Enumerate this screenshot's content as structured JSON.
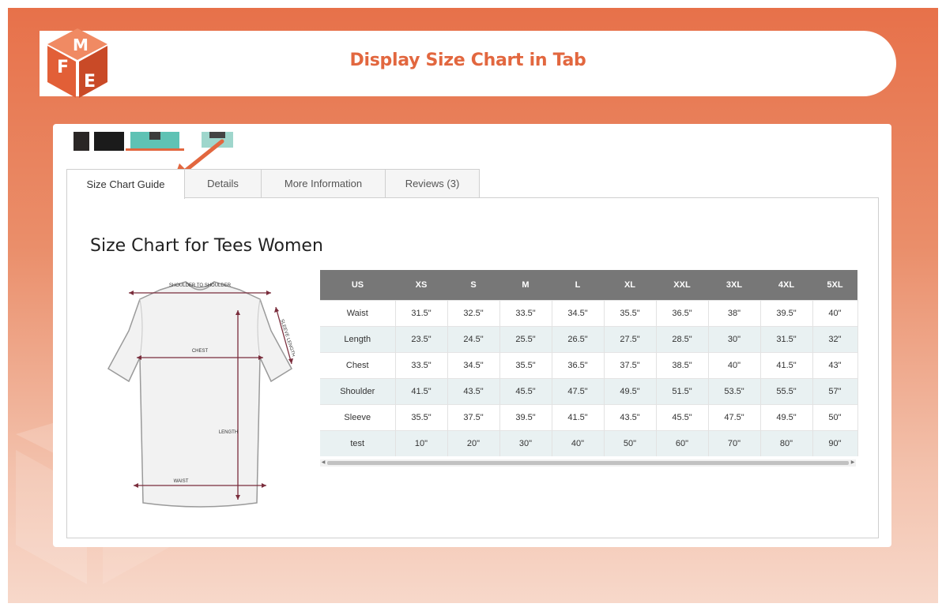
{
  "header": {
    "title": "Display Size Chart in Tab",
    "logo_letters": [
      "F",
      "M",
      "E"
    ]
  },
  "colors": {
    "accent": "#e2673f",
    "table_header": "#777777",
    "row_alt": "#e9f1f2"
  },
  "tabs": [
    {
      "label": "Size Chart Guide",
      "active": true
    },
    {
      "label": "Details",
      "active": false
    },
    {
      "label": "More Information",
      "active": false
    },
    {
      "label": "Reviews (3)",
      "active": false
    }
  ],
  "panel": {
    "title": "Size Chart for Tees Women"
  },
  "shirt_labels": {
    "shoulder": "SHOULDER TO SHOULDER",
    "chest": "CHEST",
    "sleeve": "SLEEVE LENGTH",
    "length": "LENGTH",
    "waist": "WAIST"
  },
  "table": {
    "headers": [
      "US",
      "XS",
      "S",
      "M",
      "L",
      "XL",
      "XXL",
      "3XL",
      "4XL",
      "5XL"
    ],
    "rows": [
      [
        "Waist",
        "31.5\"",
        "32.5\"",
        "33.5\"",
        "34.5\"",
        "35.5\"",
        "36.5\"",
        "38\"",
        "39.5\"",
        "40\""
      ],
      [
        "Length",
        "23.5\"",
        "24.5\"",
        "25.5\"",
        "26.5\"",
        "27.5\"",
        "28.5\"",
        "30\"",
        "31.5\"",
        "32\""
      ],
      [
        "Chest",
        "33.5\"",
        "34.5\"",
        "35.5\"",
        "36.5\"",
        "37.5\"",
        "38.5\"",
        "40\"",
        "41.5\"",
        "43\""
      ],
      [
        "Shoulder",
        "41.5\"",
        "43.5\"",
        "45.5\"",
        "47.5\"",
        "49.5\"",
        "51.5\"",
        "53.5\"",
        "55.5\"",
        "57\""
      ],
      [
        "Sleeve",
        "35.5\"",
        "37.5\"",
        "39.5\"",
        "41.5\"",
        "43.5\"",
        "45.5\"",
        "47.5\"",
        "49.5\"",
        "50\""
      ],
      [
        "test",
        "10\"",
        "20\"",
        "30\"",
        "40\"",
        "50\"",
        "60\"",
        "70\"",
        "80\"",
        "90\""
      ]
    ]
  }
}
